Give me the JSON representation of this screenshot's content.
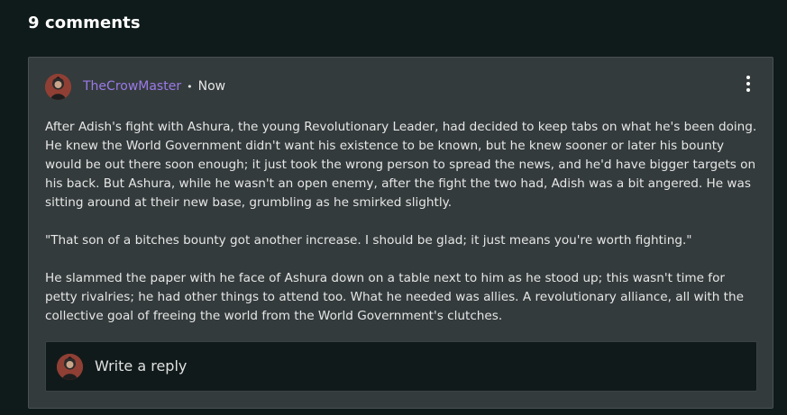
{
  "comments_heading": "9 comments",
  "comment": {
    "author": "TheCrowMaster",
    "separator": "•",
    "timestamp": "Now",
    "more_icon": "more-vertical-icon",
    "paragraphs": [
      "After Adish's fight with Ashura, the young Revolutionary Leader, had decided to keep tabs on what he's been doing. He knew the World Government didn't want his existence to be known, but he knew sooner or later his bounty would be out there soon enough; it just took the wrong person to spread the news, and he'd have bigger targets on his back. But Ashura, while he wasn't an open enemy, after the fight the two had, Adish was a bit angered. He was sitting around at their new base, grumbling as he smirked slightly.",
      "\"That son of a bitches bounty got another increase. I should be glad; it just means you're worth fighting.\"",
      "He slammed the paper with he face of Ashura down on a table next to him as he stood up; this wasn't time for petty rivalries; he had other things to attend too. What he needed was allies. A revolutionary alliance, all with the collective goal of freeing the world from the World Government's clutches."
    ]
  },
  "reply": {
    "placeholder": "Write a reply"
  },
  "colors": {
    "background": "#0f1a1a",
    "card": "#343b3c",
    "username": "#9b7ae8",
    "reply_box": "#111a1a"
  }
}
